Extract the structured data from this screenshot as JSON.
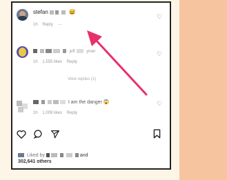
{
  "comments": [
    {
      "name": "stefan",
      "emoji": "😅",
      "time": "1h",
      "reply": "Reply",
      "more": "···"
    },
    {
      "name_suffix": "jeff",
      "name_tail": "ymer",
      "time": "1h",
      "likes": "1,555 likes",
      "reply": "Reply"
    },
    {
      "text": "I am the danger",
      "emoji": "😱",
      "time": "1h",
      "likes": "1,009 likes",
      "reply": "Reply"
    }
  ],
  "view_replies": "View replies (1)",
  "liked_by_prefix": "Liked by",
  "liked_by_and": "and",
  "liked_by_count": "302,641 others",
  "colors": {
    "arrow": "#e8306a",
    "stripe": "#f7c4a0",
    "background": "#fdf5e6"
  }
}
